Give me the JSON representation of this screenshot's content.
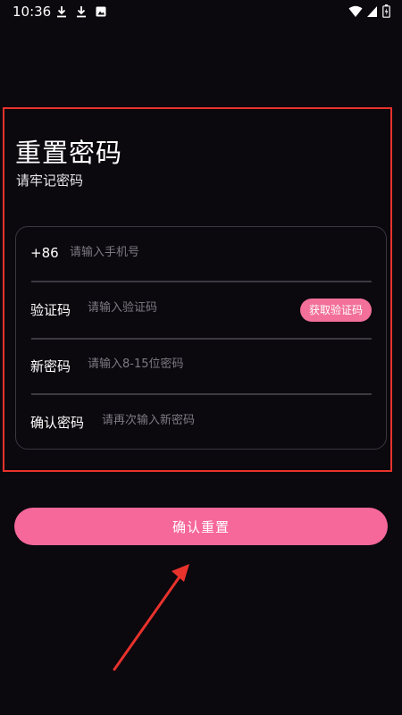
{
  "status_bar": {
    "time": "10:36",
    "icons": [
      "download-icon",
      "download-icon",
      "image-icon",
      "wifi-icon",
      "signal-icon",
      "battery-icon"
    ]
  },
  "header": {
    "title": "重置密码",
    "subtitle": "请牢记密码"
  },
  "form": {
    "phone": {
      "label": "+86",
      "placeholder": "请输入手机号",
      "value": ""
    },
    "code": {
      "label": "验证码",
      "placeholder": "请输入验证码",
      "value": "",
      "button": "获取验证码"
    },
    "new_password": {
      "label": "新密码",
      "placeholder": "请输入8-15位密码",
      "value": ""
    },
    "confirm_password": {
      "label": "确认密码",
      "placeholder": "请再次输入新密码",
      "value": ""
    }
  },
  "actions": {
    "confirm_label": "确认重置"
  },
  "colors": {
    "background": "#0b080e",
    "accent": "#f6679a",
    "highlight_border": "#e8322c",
    "annotation_arrow": "#e8322c"
  }
}
